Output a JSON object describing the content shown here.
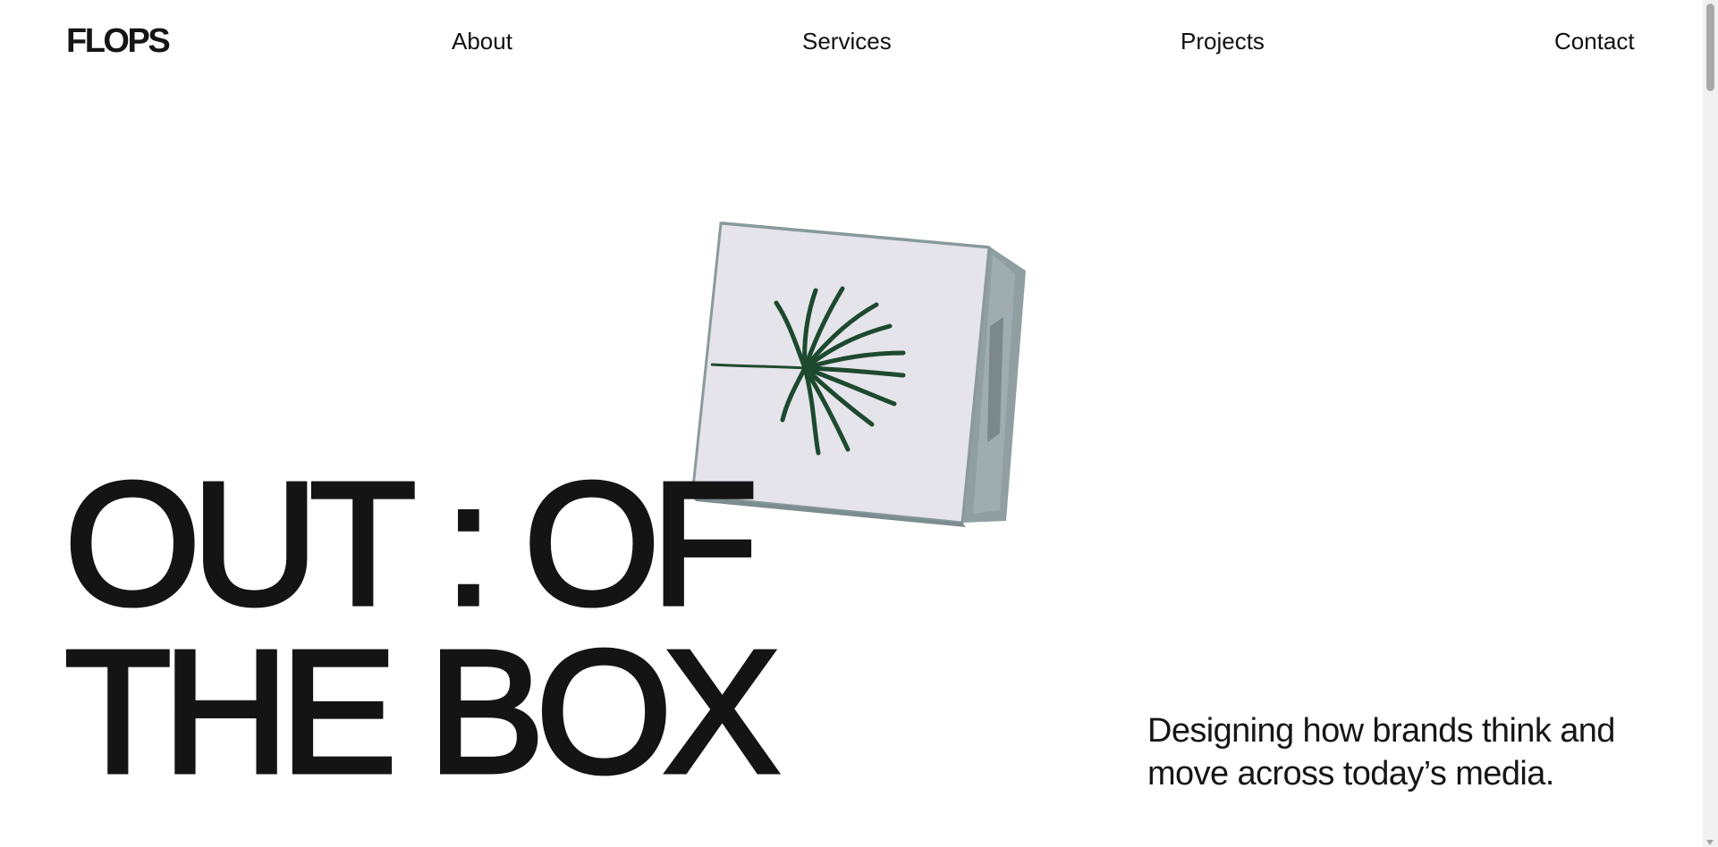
{
  "brand": {
    "logo": "FLOPS"
  },
  "nav": {
    "items": [
      {
        "label": "About"
      },
      {
        "label": "Services"
      },
      {
        "label": "Projects"
      },
      {
        "label": "Contact"
      }
    ]
  },
  "hero": {
    "title_line_1": "OUT : OF",
    "title_line_2": "THE BOX",
    "tagline": "Designing how brands think and move across today’s media."
  },
  "icons": {
    "box": "white-box-with-palm-leaf"
  },
  "colors": {
    "background": "#ffffff",
    "text": "#111111",
    "box_face": "#e6e5ea",
    "box_side": "#93a2a4",
    "leaf": "#1f4a2f"
  }
}
